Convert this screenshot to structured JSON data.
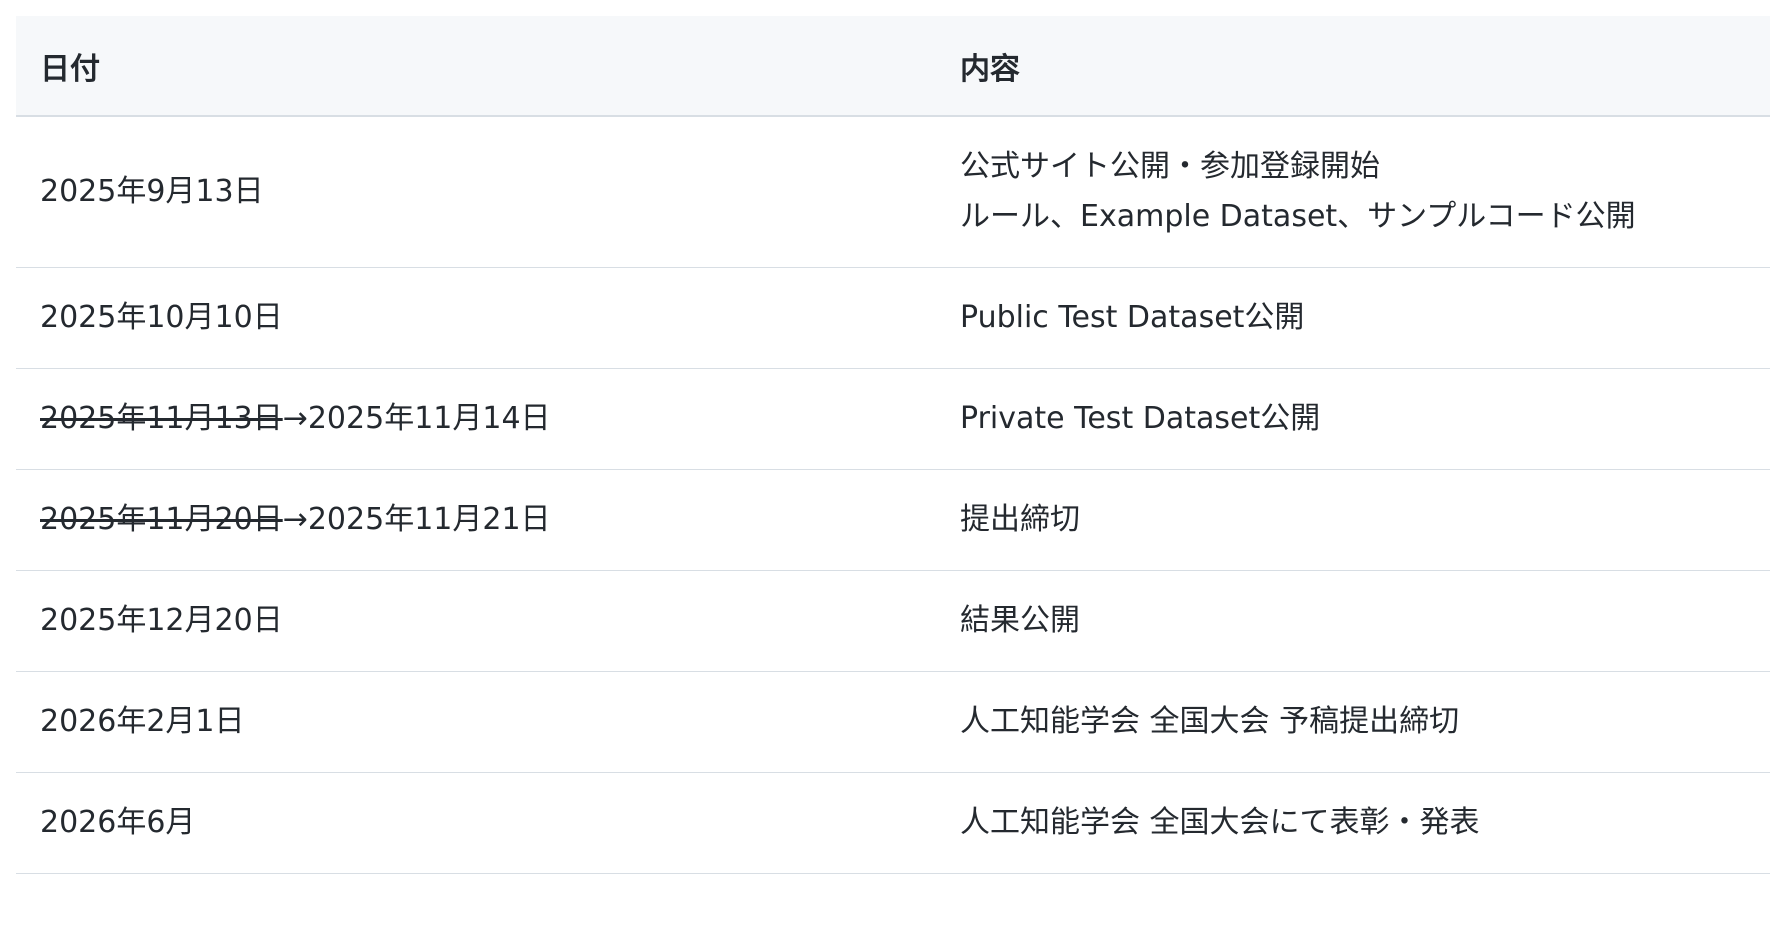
{
  "table": {
    "headers": {
      "date": "日付",
      "content": "内容"
    },
    "rows": [
      {
        "date": "2025年9月13日",
        "content_line1": "公式サイト公開・参加登録開始",
        "content_line2": "ルール、Example Dataset、サンプルコード公開"
      },
      {
        "date": "2025年10月10日",
        "content": "Public Test Dataset公開"
      },
      {
        "date_old": "2025年11月13日",
        "arrow": "→",
        "date_new": "2025年11月14日",
        "content": "Private Test Dataset公開"
      },
      {
        "date_old": "2025年11月20日",
        "arrow": "→",
        "date_new": "2025年11月21日",
        "content": "提出締切"
      },
      {
        "date": "2025年12月20日",
        "content": "結果公開"
      },
      {
        "date": "2026年2月1日",
        "content": "人工知能学会 全国大会 予稿提出締切"
      },
      {
        "date": "2026年6月",
        "content": "人工知能学会 全国大会にて表彰・発表"
      }
    ]
  }
}
